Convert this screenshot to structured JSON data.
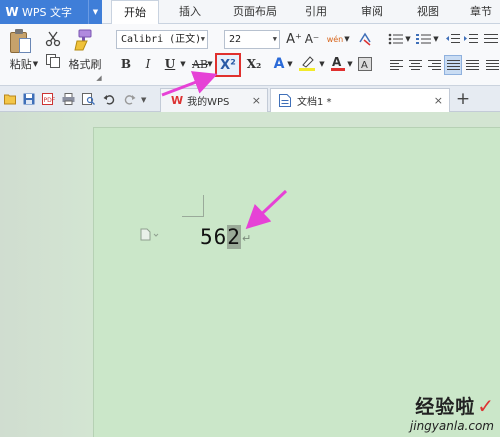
{
  "app": {
    "name": "WPS 文字",
    "logo": "W"
  },
  "menu": {
    "tabs": [
      "开始",
      "插入",
      "页面布局",
      "引用",
      "审阅",
      "视图",
      "章节"
    ],
    "active": "开始"
  },
  "ribbon": {
    "paste_label": "粘贴",
    "format_painter_label": "格式刷",
    "font_name": "Calibri (正文)",
    "font_size": "22",
    "bold": "B",
    "italic": "I",
    "underline": "U",
    "strike": "AB",
    "superscript": "X²",
    "subscript": "X₂",
    "grow": "A⁺",
    "shrink": "A⁻",
    "phonetic": "wén"
  },
  "tabs": {
    "docs": [
      {
        "name": "我的WPS",
        "close": "×"
      },
      {
        "name": "文档1 *",
        "close": "×"
      }
    ],
    "new_tab": "+"
  },
  "document": {
    "text_before": "56",
    "selected_char": "2",
    "para_mark": "↵"
  },
  "watermark": {
    "cn": "经验啦",
    "check": "✓",
    "url": "jingyanla.com"
  },
  "colors": {
    "app_blue": "#3f7ed8",
    "highlight_red": "#e0302e",
    "annotation_arrow": "#e642d6",
    "page_bg": "#cbe7c9"
  }
}
